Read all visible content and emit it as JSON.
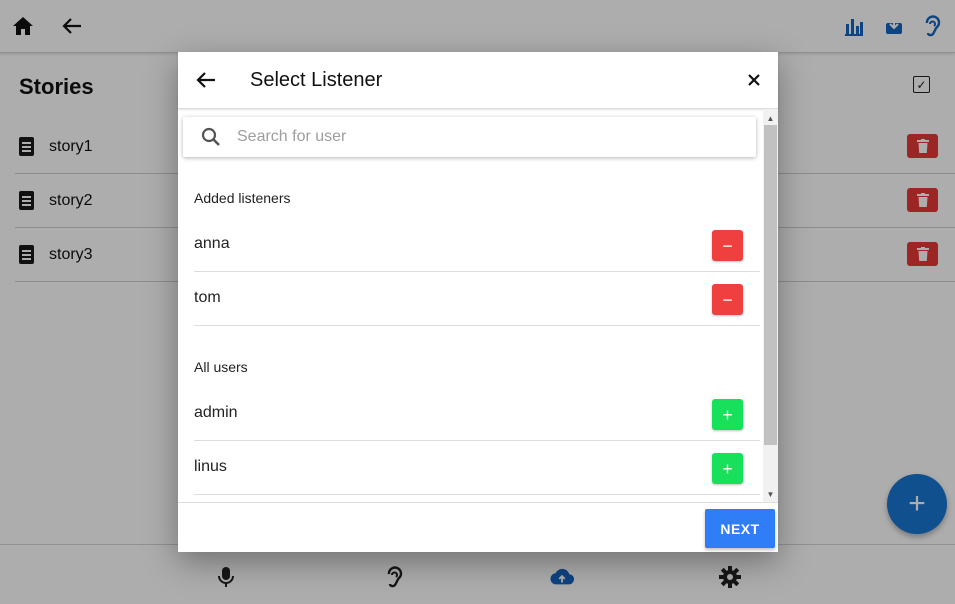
{
  "app": {
    "stories_title": "Stories",
    "stories": [
      {
        "label": "story1"
      },
      {
        "label": "story2"
      },
      {
        "label": "story3"
      }
    ],
    "fab_label": "+"
  },
  "dialog": {
    "title": "Select Listener",
    "search": {
      "placeholder": "Search for user",
      "value": ""
    },
    "added_section_label": "Added listeners",
    "added_listeners": [
      {
        "name": "anna",
        "action": "−"
      },
      {
        "name": "tom",
        "action": "−"
      }
    ],
    "all_users_section_label": "All users",
    "all_users": [
      {
        "name": "admin",
        "action": "+"
      },
      {
        "name": "linus",
        "action": "+"
      }
    ],
    "next_label": "NEXT"
  },
  "colors": {
    "primary": "#1976d2",
    "danger": "#ef3f3f",
    "success": "#19e05a",
    "next_button": "#2f7ef7"
  },
  "icons": {
    "topbar_left": [
      "home-icon",
      "back-arrow-icon"
    ],
    "topbar_right": [
      "bar-chart-icon",
      "download-icon",
      "ear-icon"
    ],
    "bottom_nav": [
      "microphone-icon",
      "ear-icon",
      "cloud-upload-icon",
      "settings-icon"
    ]
  }
}
